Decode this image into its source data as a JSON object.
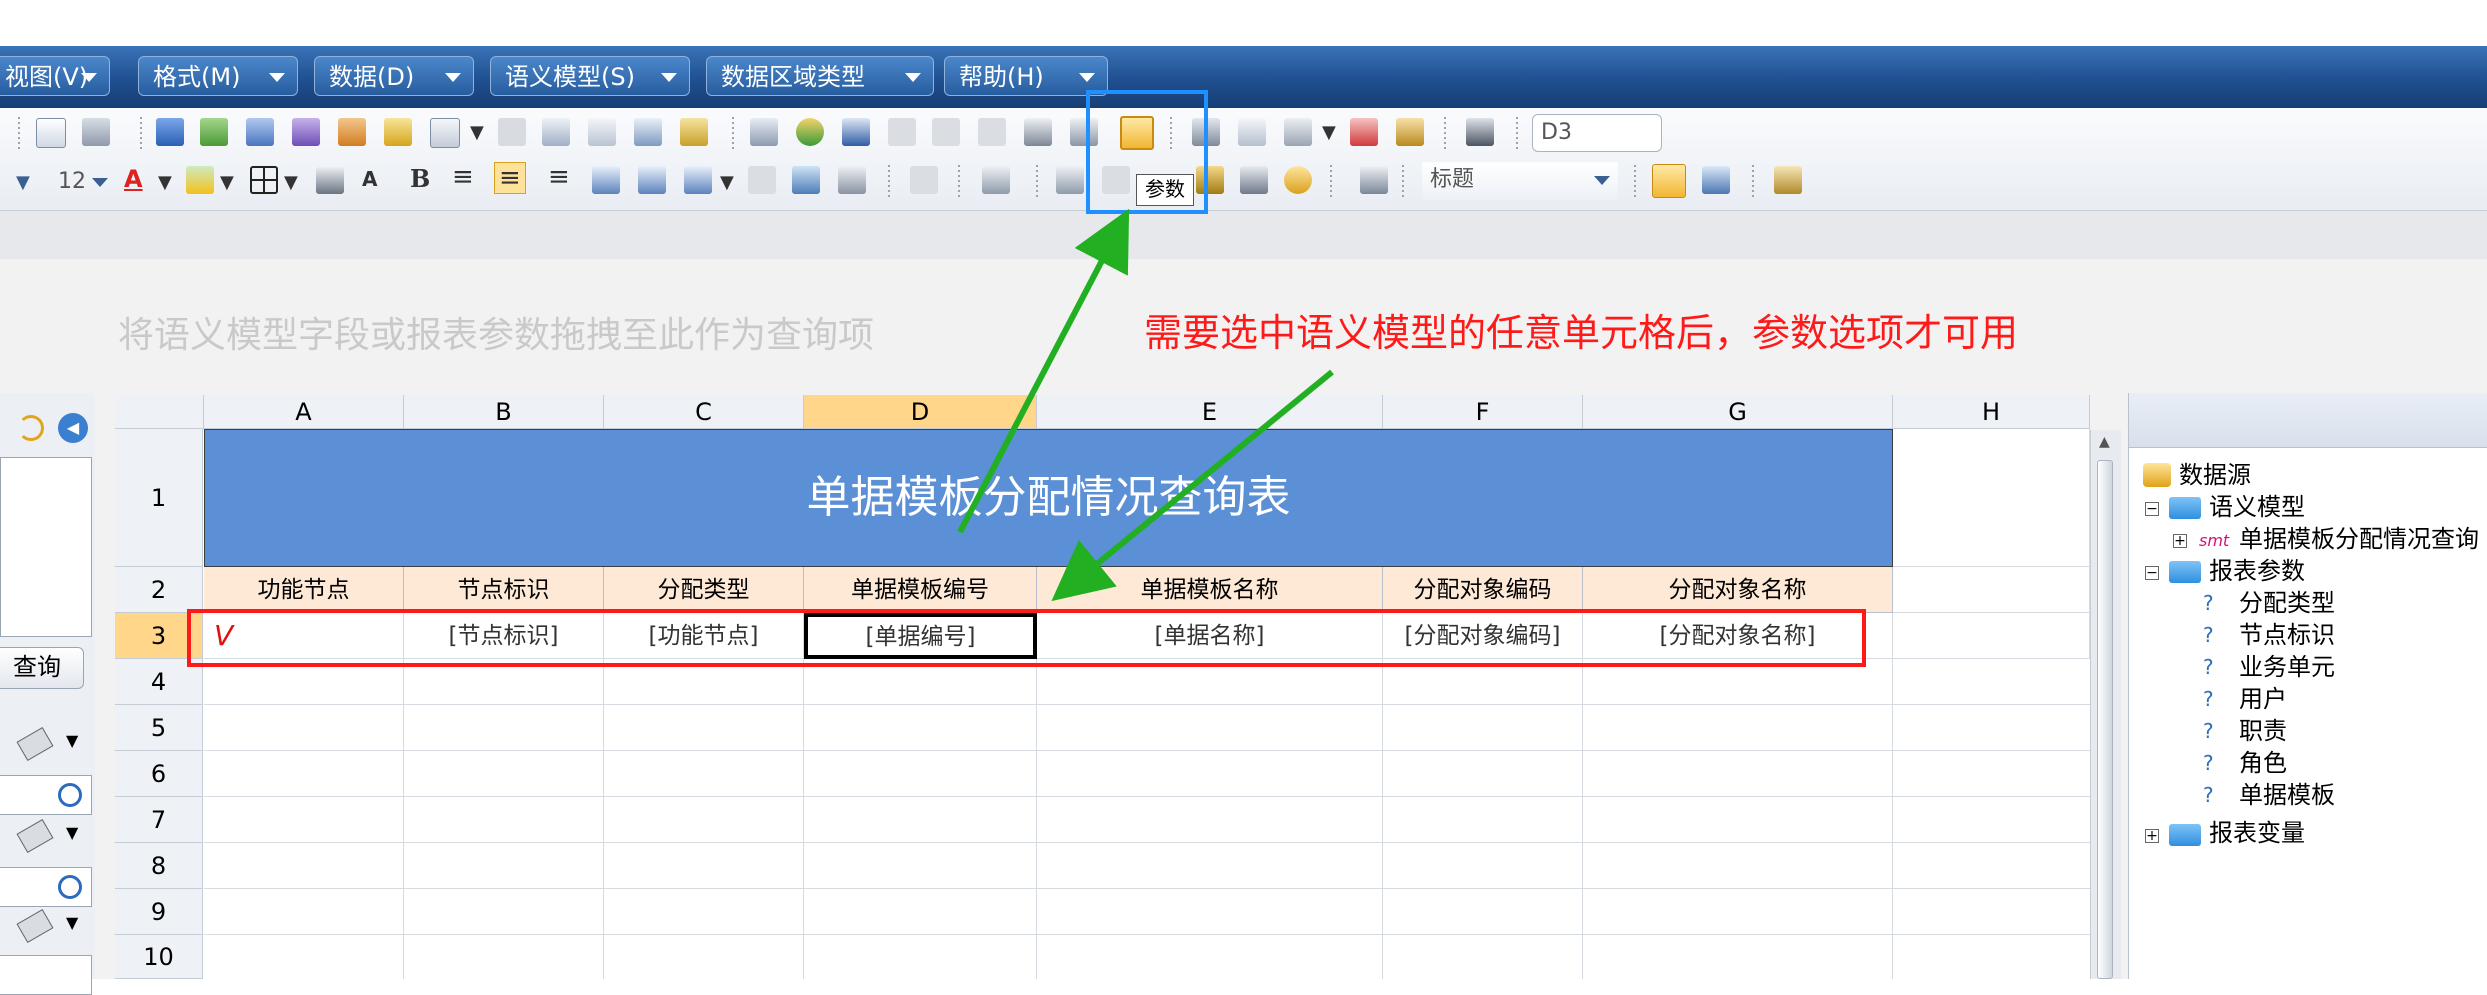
{
  "menubar": {
    "items": [
      {
        "label": "视图(V)"
      },
      {
        "label": "格式(M)"
      },
      {
        "label": "数据(D)"
      },
      {
        "label": "语义模型(S)"
      },
      {
        "label": "数据区域类型"
      },
      {
        "label": "帮助(H)"
      }
    ]
  },
  "toolbar": {
    "cell_ref": "D3",
    "font_size": "12",
    "style_name": "标题",
    "tooltip": "参数"
  },
  "query_placeholder": "将语义模型字段或报表参数拖拽至此作为查询项",
  "annotation": "需要选中语义模型的任意单元格后，参数选项才可用",
  "sheet": {
    "columns": [
      "A",
      "B",
      "C",
      "D",
      "E",
      "F",
      "G",
      "H"
    ],
    "rows": [
      "1",
      "2",
      "3",
      "4",
      "5",
      "6",
      "7",
      "8",
      "9",
      "10"
    ],
    "title": "单据模板分配情况查询表",
    "headers": [
      "功能节点",
      "节点标识",
      "分配类型",
      "单据模板编号",
      "单据模板名称",
      "分配对象编码",
      "分配对象名称"
    ],
    "row3": [
      "",
      "[节点标识]",
      "[功能节点]",
      "[单据编号]",
      "[单据名称]",
      "[分配对象编码]",
      "[分配对象名称]"
    ],
    "row3_first_mark": "V"
  },
  "left_panel": {
    "query_button": "查询"
  },
  "tree": {
    "root": "数据源",
    "semantic_model": "语义模型",
    "smt_badge": "smt",
    "smt_item": "单据模板分配情况查询",
    "report_params": "报表参数",
    "params": [
      "分配类型",
      "节点标识",
      "业务单元",
      "用户",
      "职责",
      "角色",
      "单据模板"
    ],
    "report_vars": "报表变量"
  },
  "colors": {
    "menubar": "#1f4f8f",
    "title_fill": "#5b8fd6",
    "header_fill": "#fde9d6",
    "selected_header": "#ffd68a",
    "annotation_red": "#ff1a1a",
    "arrow_green": "#22b022",
    "highlight_blue": "#1e90ff"
  }
}
